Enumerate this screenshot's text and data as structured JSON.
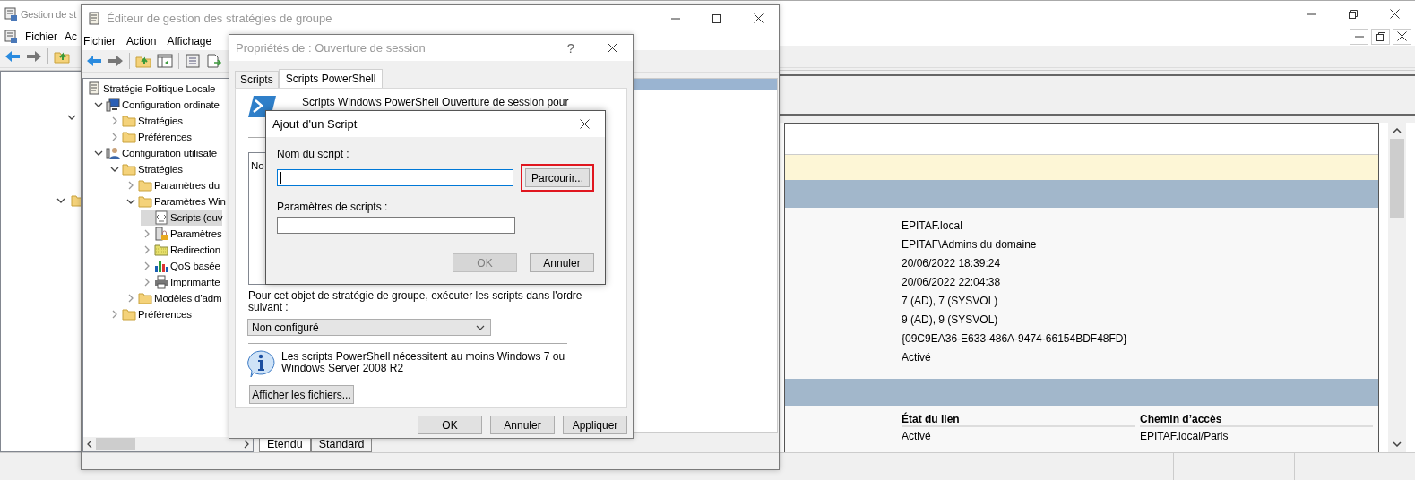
{
  "back_window": {
    "title": "Gestion de st",
    "menu": [
      "Fichier",
      "Ac"
    ],
    "details": {
      "values": [
        "EPITAF.local",
        "EPITAF\\Admins du domaine",
        "20/06/2022 18:39:24",
        "20/06/2022 22:04:38",
        "7 (AD), 7 (SYSVOL)",
        "9 (AD), 9 (SYSVOL)",
        "{09C9EA36-E633-486A-9474-66154BDF48FD}",
        "Activé"
      ]
    },
    "links_table": {
      "columns": [
        "État du lien",
        "Chemin d’accès"
      ],
      "rows": [
        {
          "cells": [
            "Activé",
            "EPITAF.local/Paris"
          ]
        }
      ]
    }
  },
  "editor": {
    "title": "Éditeur de gestion des stratégies de groupe",
    "menu": [
      "Fichier",
      "Action",
      "Affichage"
    ],
    "tree": [
      {
        "label": "Stratégie Politique Locale",
        "kind": "policy",
        "selected": false,
        "children": [
          {
            "label": "Configuration ordinate",
            "kind": "computer",
            "selected": false,
            "expanded": true,
            "children": [
              {
                "label": "Stratégies",
                "kind": "folder",
                "selected": false,
                "expanded": false
              },
              {
                "label": "Préférences",
                "kind": "folder",
                "selected": false,
                "expanded": false
              }
            ]
          },
          {
            "label": "Configuration utilisate",
            "kind": "user",
            "selected": false,
            "expanded": true,
            "children": [
              {
                "label": "Stratégies",
                "kind": "folder",
                "selected": false,
                "expanded": true,
                "children": [
                  {
                    "label": "Paramètres du",
                    "kind": "folder",
                    "selected": false,
                    "expanded": false
                  },
                  {
                    "label": "Paramètres Win",
                    "kind": "folder",
                    "selected": false,
                    "expanded": true,
                    "children": [
                      {
                        "label": "Scripts (ouv",
                        "kind": "script",
                        "selected": true
                      },
                      {
                        "label": "Paramètres",
                        "kind": "server",
                        "selected": false,
                        "expanded": false
                      },
                      {
                        "label": "Redirection",
                        "kind": "folder_pattern",
                        "selected": false,
                        "expanded": false
                      },
                      {
                        "label": "QoS basée",
                        "kind": "chart",
                        "selected": false,
                        "expanded": false
                      },
                      {
                        "label": "Imprimante",
                        "kind": "printer",
                        "selected": false,
                        "expanded": false
                      }
                    ]
                  },
                  {
                    "label": "Modèles d’adm",
                    "kind": "folder",
                    "selected": false,
                    "expanded": false
                  }
                ]
              },
              {
                "label": "Préférences",
                "kind": "folder",
                "selected": false,
                "expanded": false
              }
            ]
          }
        ]
      }
    ],
    "view_tabs": [
      {
        "label": "Etendu",
        "selected": true
      },
      {
        "label": "Standard",
        "selected": false
      }
    ]
  },
  "properties": {
    "title": "Propriétés de : Ouverture de session",
    "help": "?",
    "tabs": [
      {
        "label": "Scripts",
        "selected": false
      },
      {
        "label": "Scripts PowerShell",
        "selected": true
      }
    ],
    "heading": "Scripts Windows PowerShell Ouverture de session pour",
    "list_column": "No",
    "order_label": [
      "Pour cet objet de stratégie de groupe, exécuter les scripts dans l'ordre",
      "suivant :"
    ],
    "order_select": {
      "value": "Non configuré"
    },
    "info": [
      "Les scripts PowerShell nécessitent au moins Windows 7 ou",
      "Windows Server 2008 R2"
    ],
    "show_files_button": "Afficher les fichiers...",
    "buttons": [
      {
        "label": "OK",
        "disabled": false
      },
      {
        "label": "Annuler",
        "disabled": false
      },
      {
        "label": "Appliquer",
        "disabled": false
      }
    ]
  },
  "add_script": {
    "title": "Ajout d'un Script",
    "name_field": {
      "label": "Nom du script :",
      "focused": true
    },
    "browse_button": {
      "label": "Parcourir...",
      "highlighted": true
    },
    "params_field": {
      "label": "Paramètres de scripts :",
      "focused": false
    },
    "buttons": [
      {
        "label": "OK",
        "disabled": true
      },
      {
        "label": "Annuler",
        "disabled": false
      }
    ]
  }
}
